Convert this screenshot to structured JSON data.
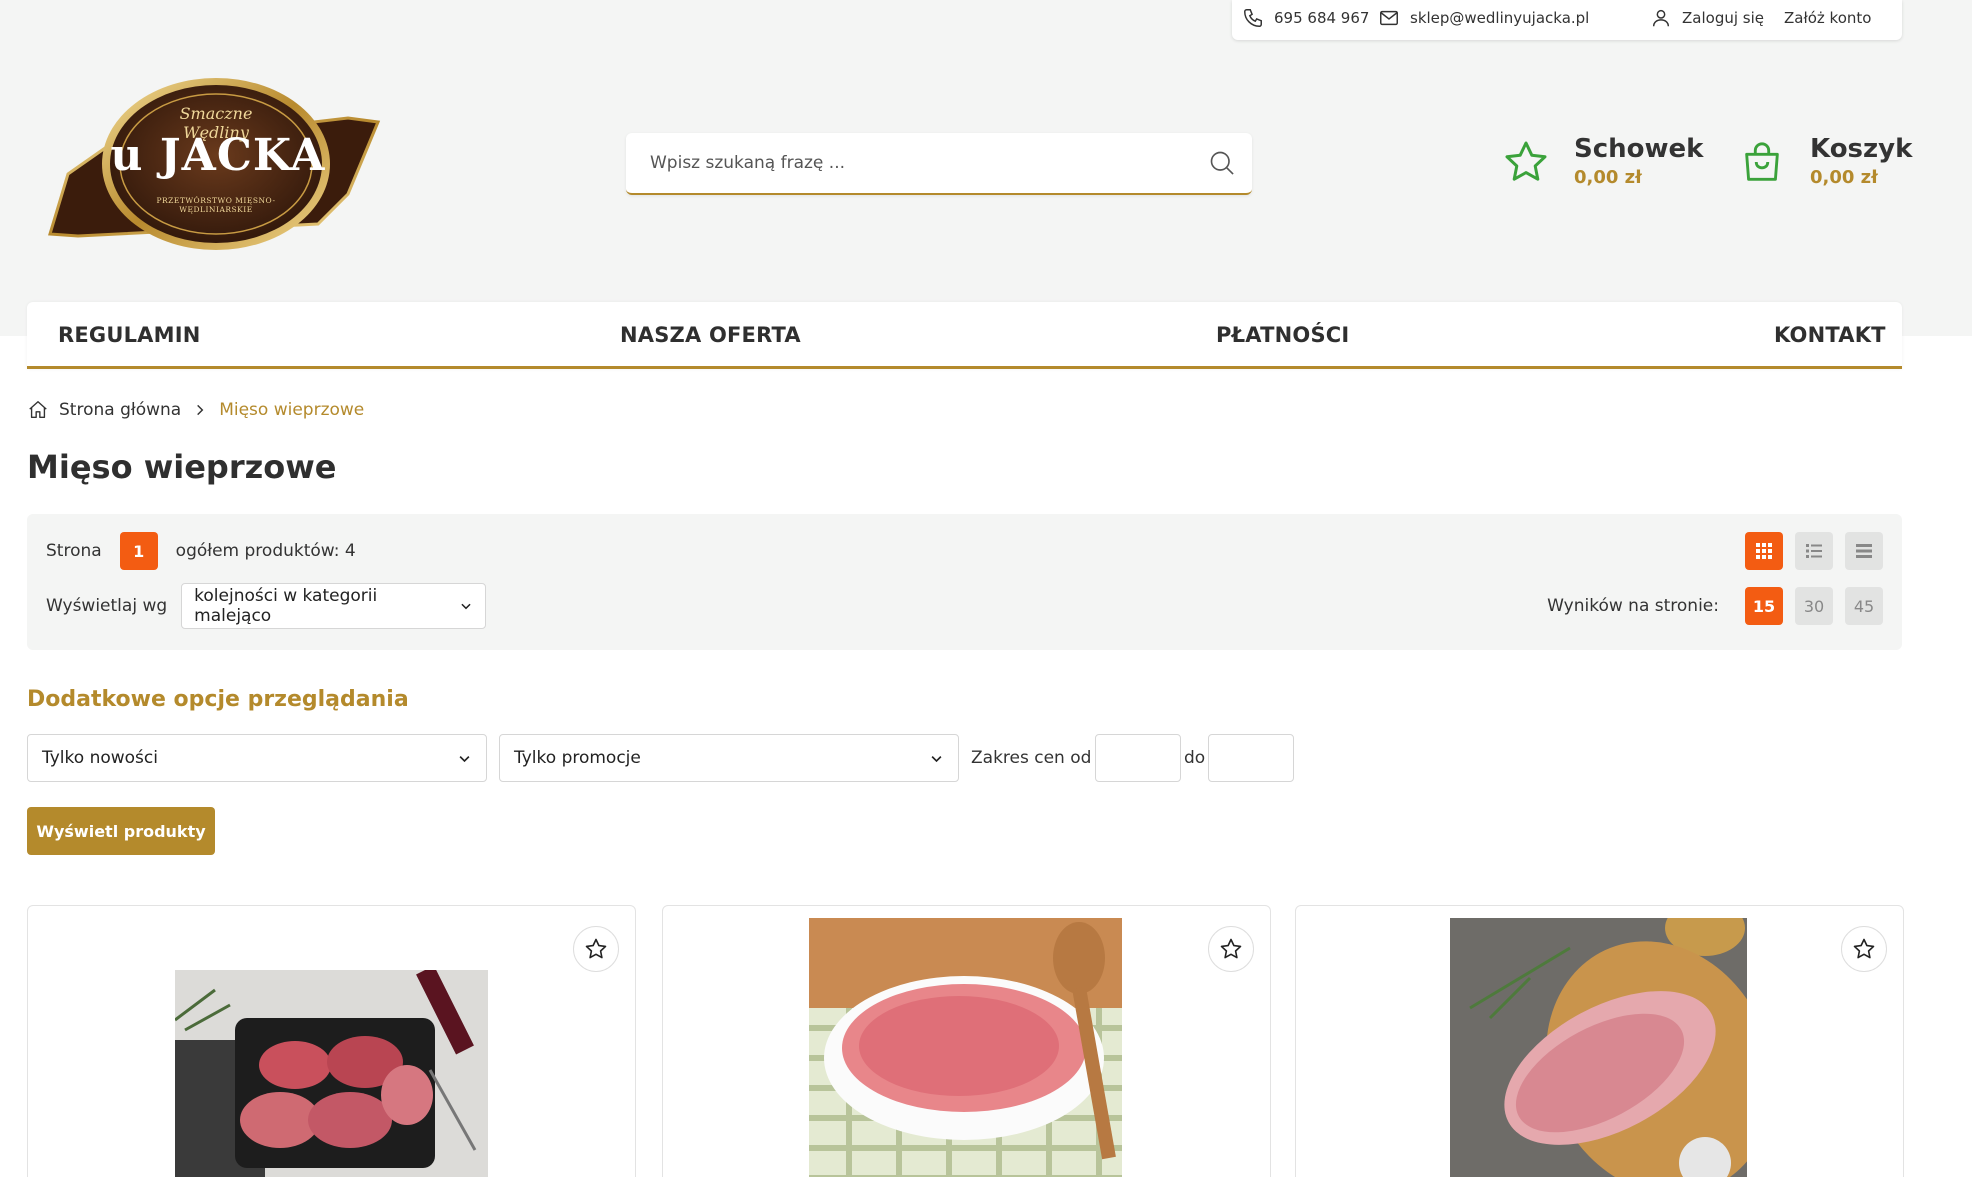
{
  "topbar": {
    "phone": "695 684 967",
    "email": "sklep@wedlinyujacka.pl",
    "login": "Zaloguj się",
    "register": "Załóż konto"
  },
  "logo": {
    "script_text": "Smaczne Wędliny",
    "main_text": "u JACKA",
    "arc_text": "PRZETWÓRSTWO MIĘSNO-WĘDLINIARSKIE"
  },
  "search": {
    "placeholder": "Wpisz szukaną frazę ..."
  },
  "wishlist": {
    "title": "Schowek",
    "value": "0,00 zł"
  },
  "cart": {
    "title": "Koszyk",
    "value": "0,00 zł"
  },
  "nav": {
    "items": [
      {
        "label": "REGULAMIN"
      },
      {
        "label": "NASZA OFERTA"
      },
      {
        "label": "PŁATNOŚCI"
      },
      {
        "label": "KONTAKT"
      }
    ]
  },
  "breadcrumb": {
    "home": "Strona główna",
    "current": "Mięso wieprzowe"
  },
  "page": {
    "title": "Mięso wieprzowe"
  },
  "toolbar": {
    "page_label": "Strona",
    "page_number": "1",
    "total_label": "ogółem produktów: 4",
    "sort_label": "Wyświetlaj wg",
    "sort_value": "kolejności w kategorii malejąco",
    "per_page_label": "Wyników na stronie:",
    "per_page_options": [
      "15",
      "30",
      "45"
    ],
    "per_page_selected": "15"
  },
  "filters": {
    "title": "Dodatkowe opcje przeglądania",
    "new_only": "Tylko nowości",
    "promo_only": "Tylko promocje",
    "price_from_label": "Zakres cen od",
    "price_to_label": "do",
    "submit": "Wyświetl produkty"
  },
  "colors": {
    "accent_gold": "#b48a2c",
    "accent_orange": "#f35c12",
    "icon_green": "#3aa23a",
    "header_bg": "#f4f5f4"
  }
}
